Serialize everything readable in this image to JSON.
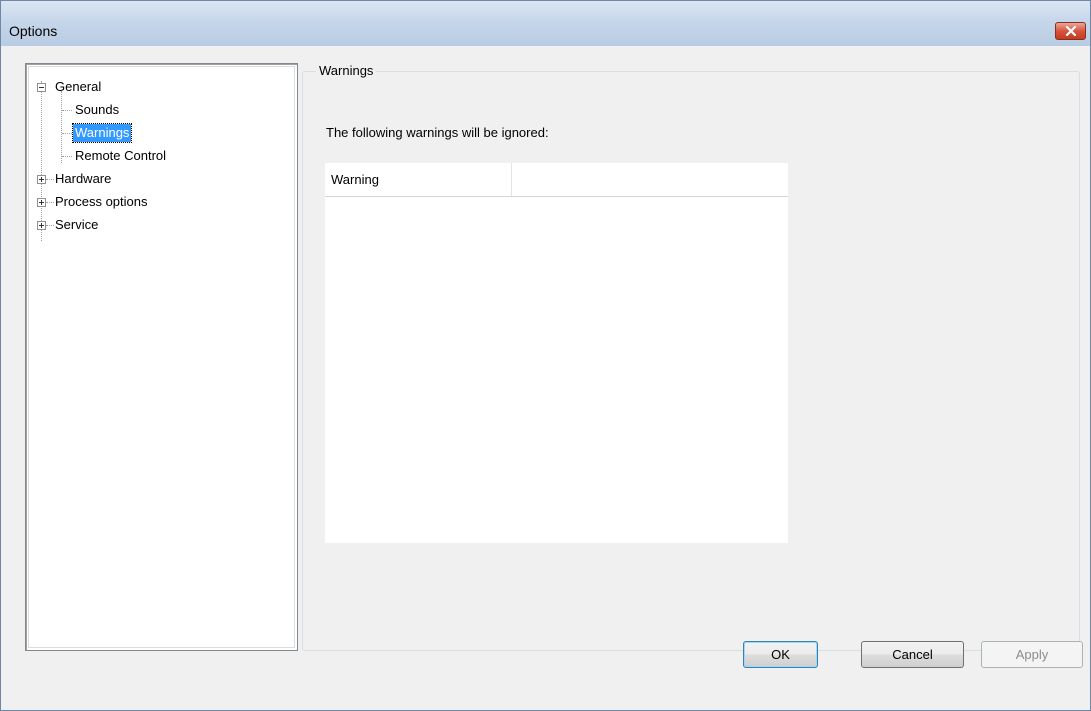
{
  "window": {
    "title": "Options"
  },
  "tree": {
    "items": [
      {
        "label": "General",
        "expander": "minus"
      },
      {
        "label": "Sounds"
      },
      {
        "label": "Warnings",
        "selected": true
      },
      {
        "label": "Remote Control"
      },
      {
        "label": "Hardware",
        "expander": "plus"
      },
      {
        "label": "Process options",
        "expander": "plus"
      },
      {
        "label": "Service",
        "expander": "plus"
      }
    ]
  },
  "panel": {
    "group_title": "Warnings",
    "intro": "The following warnings will be ignored:",
    "list": {
      "columns": [
        "Warning",
        ""
      ],
      "rows": []
    }
  },
  "buttons": {
    "ok": "OK",
    "cancel": "Cancel",
    "apply": "Apply"
  },
  "colors": {
    "selection": "#3399ff",
    "close_button": "#d9533b"
  }
}
